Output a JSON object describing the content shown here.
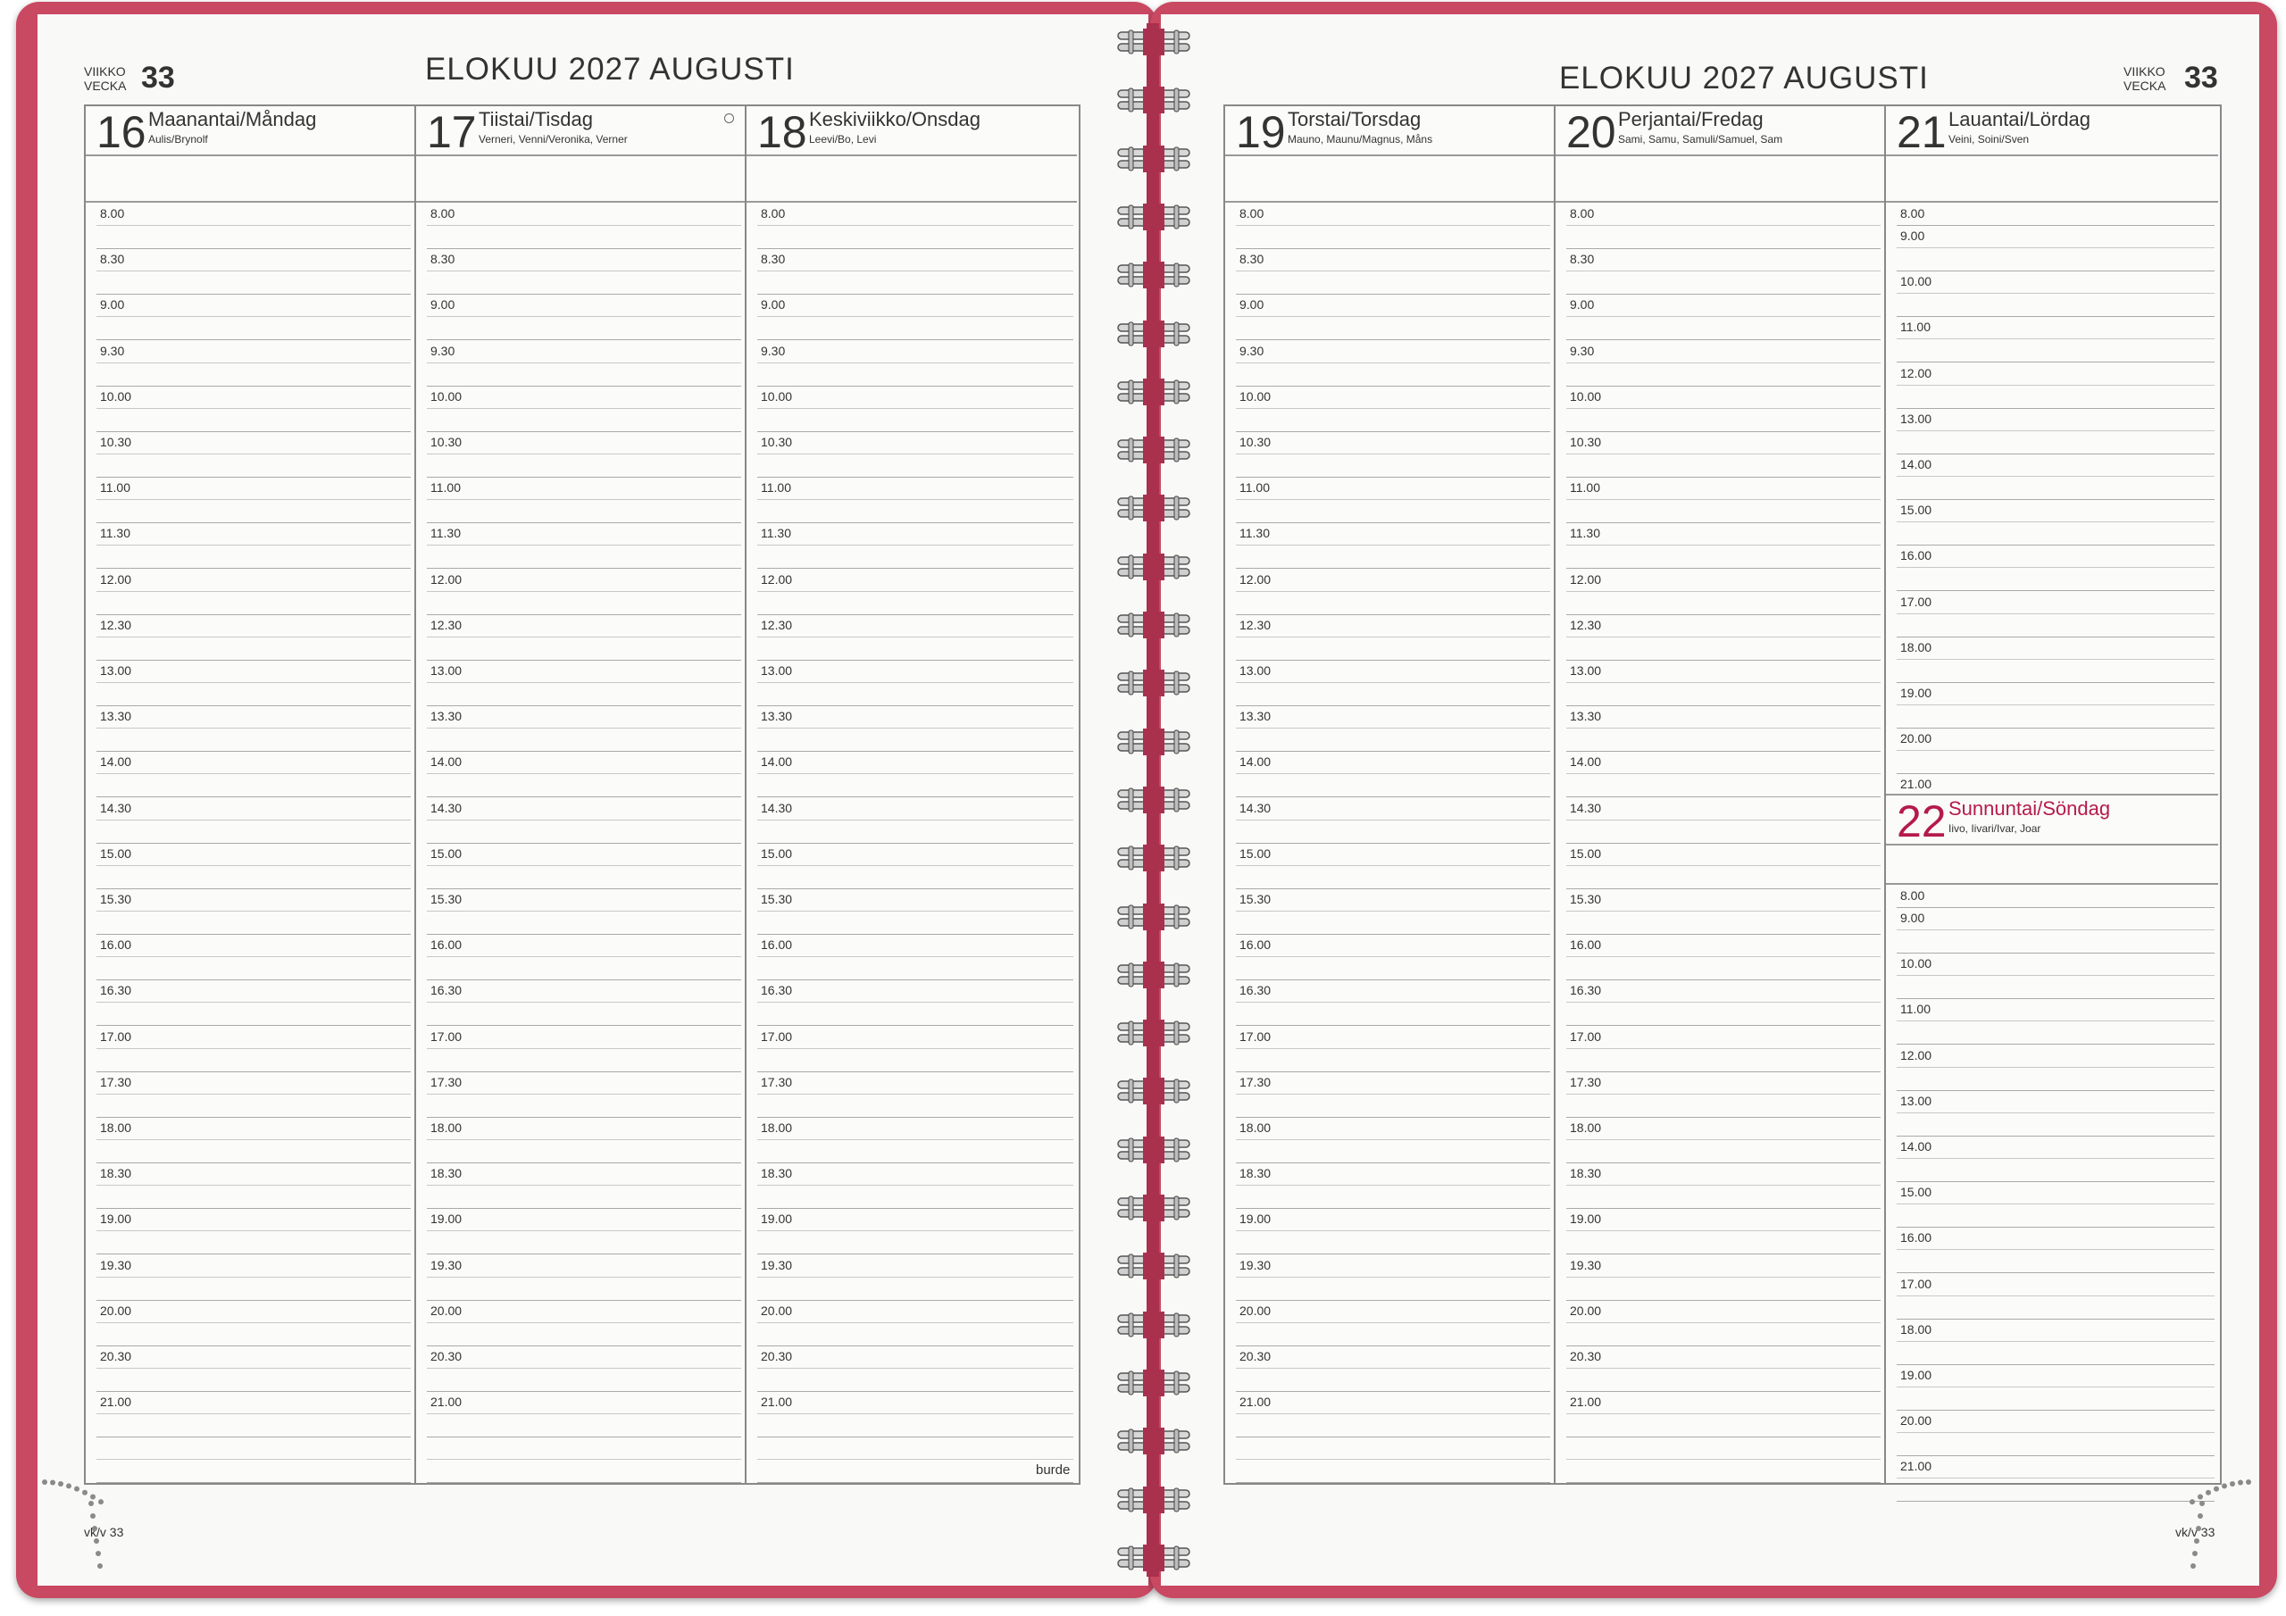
{
  "left_page": {
    "week_label_1": "VIIKKO",
    "week_label_2": "VECKA",
    "week_number": "33",
    "title": "ELOKUU 2027 AUGUSTI",
    "footer": "vk/v 33",
    "brand": "burde",
    "days": [
      {
        "num": "16",
        "name": "Maanantai/Måndag",
        "names": "Aulis/Brynolf"
      },
      {
        "num": "17",
        "name": "Tiistai/Tisdag",
        "names": "Verneri, Venni/Veronika, Verner",
        "moon": true
      },
      {
        "num": "18",
        "name": "Keskiviikko/Onsdag",
        "names": "Leevi/Bo, Levi"
      }
    ]
  },
  "right_page": {
    "week_label_1": "VIIKKO",
    "week_label_2": "VECKA",
    "week_number": "33",
    "title": "ELOKUU 2027 AUGUSTI",
    "footer": "vk/v 33",
    "days": [
      {
        "num": "19",
        "name": "Torstai/Torsdag",
        "names": "Mauno, Maunu/Magnus, Måns"
      },
      {
        "num": "20",
        "name": "Perjantai/Fredag",
        "names": "Sami, Samu, Samuli/Samuel, Sam"
      },
      {
        "num": "21",
        "name": "Lauantai/Lördag",
        "names": "Veini, Soini/Sven"
      }
    ],
    "sunday": {
      "num": "22",
      "name": "Sunnuntai/Söndag",
      "names": "Iivo, Iivari/Ivar, Joar"
    }
  },
  "times": [
    "8.00",
    "8.30",
    "9.00",
    "9.30",
    "10.00",
    "10.30",
    "11.00",
    "11.30",
    "12.00",
    "12.30",
    "13.00",
    "13.30",
    "14.00",
    "14.30",
    "15.00",
    "15.30",
    "16.00",
    "16.30",
    "17.00",
    "17.30",
    "18.00",
    "18.30",
    "19.00",
    "19.30",
    "20.00",
    "20.30",
    "21.00"
  ],
  "weekend_times": [
    "8.00",
    "9.00",
    "10.00",
    "11.00",
    "12.00",
    "13.00",
    "14.00",
    "15.00",
    "16.00",
    "17.00",
    "18.00",
    "19.00",
    "20.00",
    "21.00"
  ],
  "colors": {
    "cover": "#c94862",
    "sunday": "#b51a4c"
  }
}
